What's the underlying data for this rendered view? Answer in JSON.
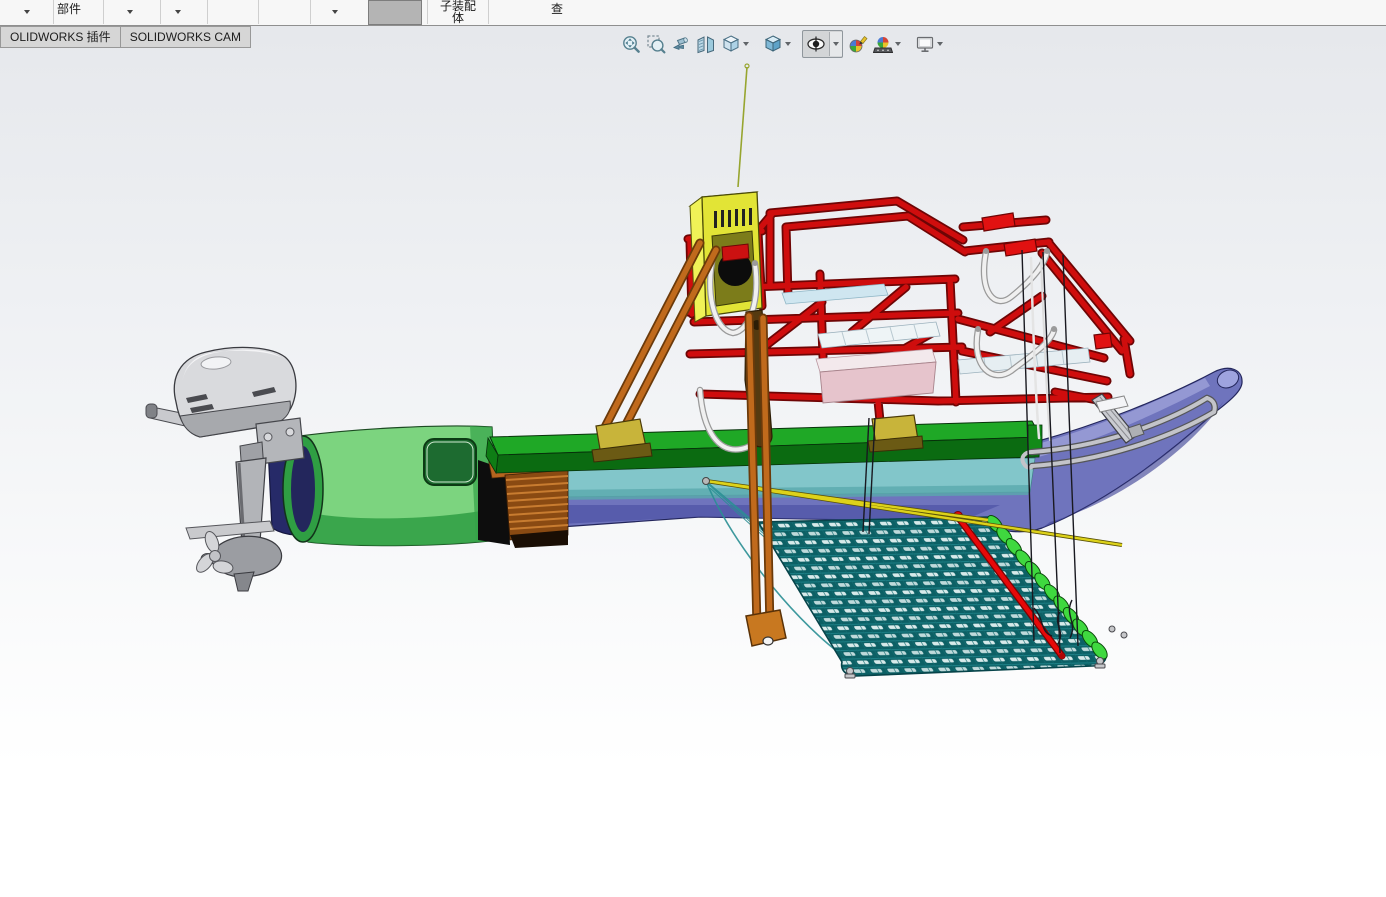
{
  "command_bar": {
    "component_label": "部件",
    "subassembly_label_line1": "子装配",
    "subassembly_label_line2": "体",
    "evaluate_label": "查",
    "tabs": [
      {
        "label": "OLIDWORKS 插件"
      },
      {
        "label": "SOLIDWORKS CAM"
      }
    ]
  },
  "heads_up_toolbar": {
    "buttons": [
      {
        "name": "zoom-to-fit"
      },
      {
        "name": "zoom-to-area"
      },
      {
        "name": "previous-view"
      },
      {
        "name": "section-view"
      },
      {
        "name": "view-orientation",
        "has_dropdown": true
      },
      {
        "name": "display-style",
        "has_dropdown": true
      },
      {
        "name": "hide-show-items",
        "has_dropdown": true,
        "selected": true
      },
      {
        "name": "edit-appearance"
      },
      {
        "name": "apply-scene",
        "has_dropdown": true
      },
      {
        "name": "view-settings",
        "has_dropdown": true
      }
    ]
  },
  "viewport": {
    "background_top": "#e6e8ec",
    "background_bottom": "#ffffff"
  },
  "colors": {
    "pontoon_hull": "#6f74bd",
    "hull_stripe": "#82c6ca",
    "steel_band": "#5d8a9b",
    "deck_green": "#1fa826",
    "bow_section_green": "#7cd47f",
    "transom_navy": "#262a68",
    "slat_brown": "#8a4a12",
    "slat_orange": "#b5651f",
    "equipment_box_yellow": "#e2e436",
    "frame_red": "#cf0d0d",
    "pole_orange": "#c06a1c",
    "net_teal": "#0c6065",
    "net_bar_red": "#e60909",
    "float_green": "#3fd83f",
    "motor_gray": "#d9dadd",
    "hose_white": "#f0f0f0",
    "cable_black": "#191920",
    "rod_yellow": "#ddd21a",
    "bracket_yellow": "#c8b43a",
    "cargo_pink": "#e6c4cc"
  }
}
